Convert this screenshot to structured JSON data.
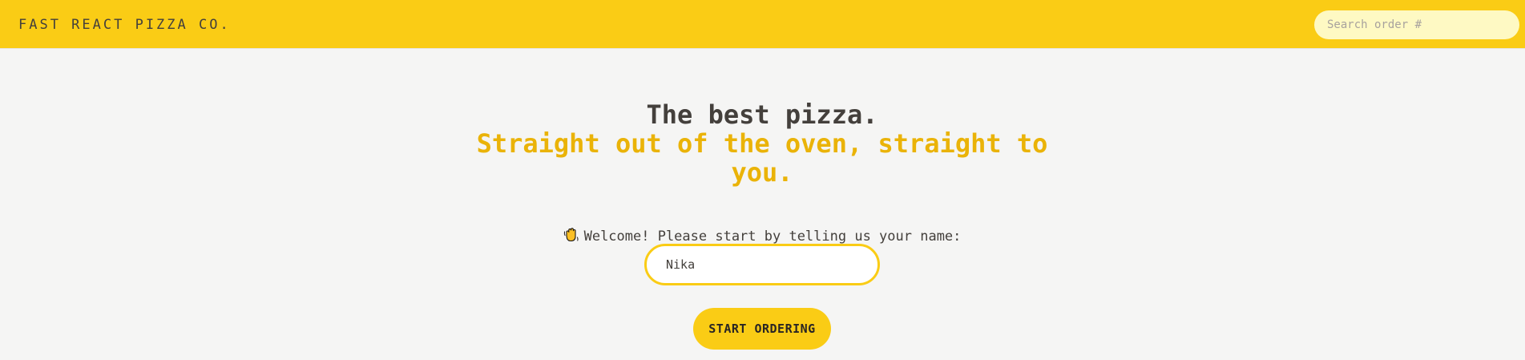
{
  "header": {
    "logo": "FAST REACT PIZZA CO.",
    "search_placeholder": "Search order #"
  },
  "home": {
    "title_line1": "The best pizza.",
    "title_line2": "Straight out of the oven, straight to you.",
    "prompt": "Welcome! Please start by telling us your name:",
    "prompt_icon": "waving-hand-icon",
    "name_value": "Nika",
    "start_button": "START ORDERING"
  },
  "colors": {
    "accent": "#facc15",
    "accent_light": "#fef9c3",
    "title_accent": "#eab308",
    "text": "#44403c",
    "background": "#f5f5f4"
  }
}
